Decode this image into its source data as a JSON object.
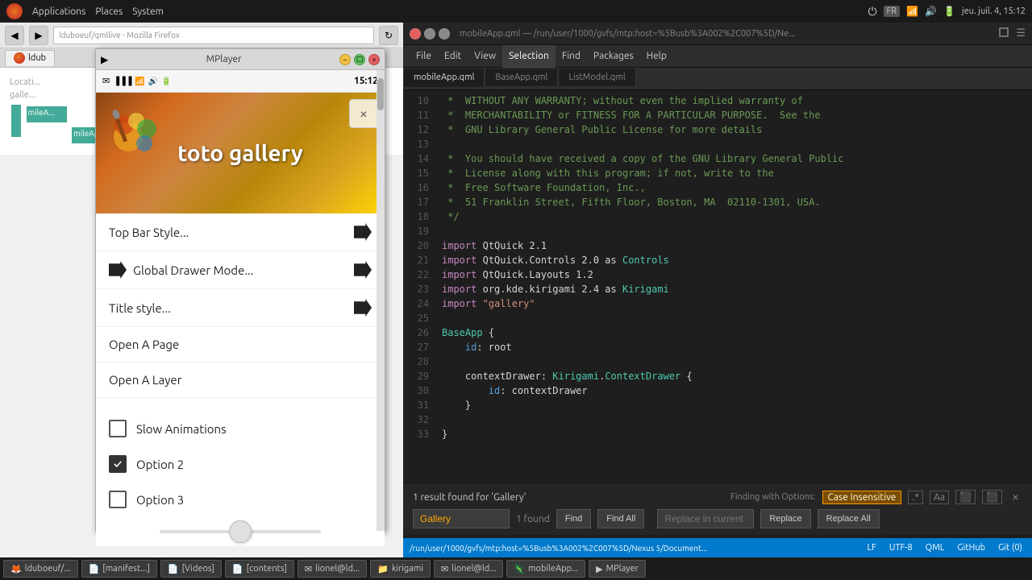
{
  "system_bar": {
    "left_items": [
      "Applications",
      "Places",
      "System"
    ],
    "right_items": [
      "FR",
      "jeu. juil. 4, 15:12"
    ]
  },
  "firefox": {
    "tab_label": "ldub",
    "url": "lduboeuf/qmllive - Mozilla Firefox"
  },
  "mplayer": {
    "title": "MPlayer",
    "time": "15:12",
    "gallery_title": "toto gallery",
    "close_label": "×",
    "menu_items": [
      {
        "label": "Top Bar Style...",
        "has_arrow_right": true,
        "has_arrow_left": false
      },
      {
        "label": "Global Drawer Mode...",
        "has_arrow_right": true,
        "has_arrow_left": true
      },
      {
        "label": "Title style...",
        "has_arrow_right": true,
        "has_arrow_left": false
      },
      {
        "label": "Open A Page",
        "has_arrow_right": false,
        "has_arrow_left": false
      },
      {
        "label": "Open A Layer",
        "has_arrow_right": false,
        "has_arrow_left": false
      }
    ],
    "checkboxes": [
      {
        "label": "Slow Animations",
        "checked": false
      },
      {
        "label": "Option 2",
        "checked": true
      },
      {
        "label": "Option 3",
        "checked": false
      }
    ]
  },
  "editor": {
    "title": "mobileApp.qml — /run/user/1000/gvfs/mtp:host=%5Busb%3A002%2C007%5D/Ne...",
    "tabs": [
      "mobileApp.qml",
      "BaseApp.qml",
      "ListModel.qml"
    ],
    "active_tab": "mobileApp.qml",
    "menu_items": [
      "File",
      "Edit",
      "View",
      "Selection",
      "Find",
      "Packages",
      "Help"
    ],
    "active_menu": "Selection",
    "lines": [
      {
        "num": 10,
        "content": " *  WITHOUT ANY WARRANTY; without even the implied warranty of",
        "type": "comment"
      },
      {
        "num": 11,
        "content": " *  MERCHANTABILITY or FITNESS FOR A PARTICULAR PURPOSE.  See the",
        "type": "comment"
      },
      {
        "num": 12,
        "content": " *  GNU Library General Public License for more details",
        "type": "comment"
      },
      {
        "num": 13,
        "content": "",
        "type": "normal"
      },
      {
        "num": 14,
        "content": " *  You should have received a copy of the GNU Library General Public",
        "type": "comment"
      },
      {
        "num": 15,
        "content": " *  License along with this program; if not, write to the",
        "type": "comment"
      },
      {
        "num": 16,
        "content": " *  Free Software Foundation, Inc.,",
        "type": "comment"
      },
      {
        "num": 17,
        "content": " *  51 Franklin Street, Fifth Floor, Boston, MA  02110-1301, USA.",
        "type": "comment"
      },
      {
        "num": 18,
        "content": " */",
        "type": "comment"
      },
      {
        "num": 19,
        "content": "",
        "type": "normal"
      },
      {
        "num": 20,
        "content": "import QtQuick 2.1",
        "type": "import"
      },
      {
        "num": 21,
        "content": "import QtQuick.Controls 2.0 as Controls",
        "type": "import"
      },
      {
        "num": 22,
        "content": "import QtQuick.Layouts 1.2",
        "type": "import"
      },
      {
        "num": 23,
        "content": "import org.kde.kirigami 2.4 as Kirigami",
        "type": "import"
      },
      {
        "num": 24,
        "content": "import \"gallery\"",
        "type": "import"
      },
      {
        "num": 25,
        "content": "",
        "type": "normal"
      },
      {
        "num": 26,
        "content": "BaseApp {",
        "type": "normal"
      },
      {
        "num": 27,
        "content": "    id: root",
        "type": "normal"
      },
      {
        "num": 28,
        "content": "",
        "type": "normal"
      },
      {
        "num": 29,
        "content": "    contextDrawer: Kirigami.ContextDrawer {",
        "type": "normal"
      },
      {
        "num": 30,
        "content": "        id: contextDrawer",
        "type": "normal"
      },
      {
        "num": 31,
        "content": "    }",
        "type": "normal"
      },
      {
        "num": 32,
        "content": "",
        "type": "normal"
      },
      {
        "num": 33,
        "content": "}",
        "type": "normal"
      }
    ],
    "find": {
      "query": "Gallery",
      "result_text": "1 result found for 'Gallery'",
      "options_text": "Finding with Options:",
      "case_insensitive": "Case Insensitive",
      "replace_placeholder": "Replace in current buffer",
      "buttons": [
        "Find",
        "Find All",
        "Replace",
        "Replace All"
      ]
    },
    "status_bar": {
      "items": [
        "LF",
        "UTF-8",
        "QML",
        "GitHub",
        "Git (0)"
      ],
      "path": "/run/user/1000/gvfs/mtp:host=%5Busb%3A002%2C007%5D/Nexus 5/Document..."
    }
  },
  "taskbar": {
    "items": [
      {
        "icon": "🦊",
        "label": "lduboeuf/..."
      },
      {
        "icon": "📄",
        "label": "[manifest...]"
      },
      {
        "icon": "📄",
        "label": "[Videos]"
      },
      {
        "icon": "📄",
        "label": "[contents]"
      },
      {
        "icon": "✉",
        "label": "lionel@ld..."
      },
      {
        "icon": "📁",
        "label": "kirigami"
      },
      {
        "icon": "✉",
        "label": "lionel@ld..."
      },
      {
        "icon": "🦎",
        "label": "mobileApp..."
      },
      {
        "icon": "▶",
        "label": "MPlayer"
      }
    ]
  },
  "browser_url": "lduboeuf/qmllive - Mozilla Firefox"
}
